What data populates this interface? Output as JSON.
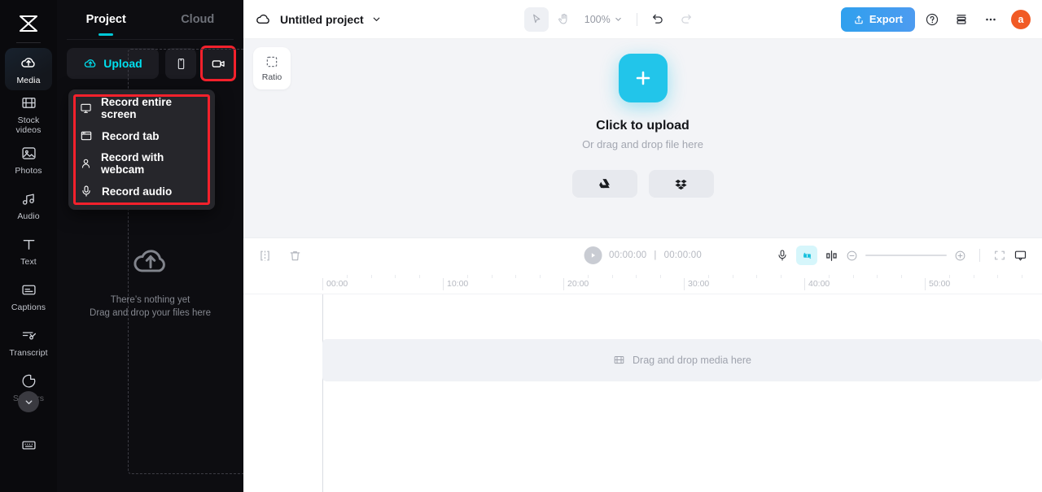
{
  "app": {
    "name": "CapCut",
    "logo_icon": "capcut-logo-icon"
  },
  "rail": {
    "items": [
      {
        "label": "Media",
        "icon": "cloud-upload-icon",
        "active": true
      },
      {
        "label": "Stock\nvideos",
        "icon": "film-strip-icon",
        "active": false
      },
      {
        "label": "Photos",
        "icon": "image-icon",
        "active": false
      },
      {
        "label": "Audio",
        "icon": "music-note-icon",
        "active": false
      },
      {
        "label": "Text",
        "icon": "text-t-icon",
        "active": false
      },
      {
        "label": "Captions",
        "icon": "captions-icon",
        "active": false
      },
      {
        "label": "Transcript",
        "icon": "transcript-icon",
        "active": false
      },
      {
        "label": "Stickers",
        "icon": "sticker-icon",
        "active": false
      }
    ],
    "expand_icon": "chevron-down-icon",
    "bottom_icon": "keyboard-icon"
  },
  "panel": {
    "tabs": [
      {
        "label": "Project",
        "active": true
      },
      {
        "label": "Cloud",
        "active": false
      }
    ],
    "upload_label": "Upload",
    "upload_icon": "cloud-upload-icon",
    "phone_icon": "phone-icon",
    "record_icon": "video-camera-icon",
    "highlight_color": "#f5212c",
    "dropdown": {
      "items": [
        {
          "label": "Record entire screen",
          "icon": "monitor-icon"
        },
        {
          "label": "Record tab",
          "icon": "browser-tab-icon"
        },
        {
          "label": "Record with webcam",
          "icon": "person-icon"
        },
        {
          "label": "Record audio",
          "icon": "microphone-icon"
        }
      ]
    },
    "empty": {
      "icon": "cloud-upload-icon",
      "line1": "There’s nothing yet",
      "line2": "Drag and drop your files here"
    },
    "collapse_icon": "chevron-left-icon"
  },
  "topbar": {
    "cloud_icon": "cloud-icon",
    "project_title": "Untitled project",
    "title_chevron_icon": "chevron-down-icon",
    "select_tool_icon": "cursor-arrow-icon",
    "hand_tool_icon": "hand-icon",
    "zoom_value": "100%",
    "zoom_chevron_icon": "chevron-down-icon",
    "undo_icon": "undo-icon",
    "redo_icon": "redo-icon",
    "export_label": "Export",
    "export_icon": "share-upload-icon",
    "export_color": "#2fa0ee",
    "help_icon": "question-circle-icon",
    "layers_icon": "layers-icon",
    "more_icon": "ellipsis-icon",
    "avatar_letter": "a",
    "avatar_color": "#f15a24"
  },
  "canvas": {
    "ratio_label": "Ratio",
    "ratio_icon": "crop-frame-icon",
    "plus_icon": "plus-icon",
    "plus_color": "#22c5ea",
    "upload_title": "Click to upload",
    "upload_subtitle": "Or drag and drop file here",
    "cloud_buttons": [
      {
        "name": "google-drive",
        "icon": "google-drive-icon"
      },
      {
        "name": "dropbox",
        "icon": "dropbox-icon"
      }
    ]
  },
  "timeline": {
    "split_icon": "split-clip-icon",
    "delete_icon": "trash-icon",
    "play_icon": "play-icon",
    "current_time": "00:00:00",
    "time_separator": "|",
    "total_time": "00:00:00",
    "mic_icon": "microphone-icon",
    "magic_icon": "auto-edit-icon",
    "magic_color": "#22c5ea",
    "mix_icon": "split-screen-icon",
    "zoom_out_icon": "minus-circle-icon",
    "zoom_in_icon": "plus-circle-icon",
    "fit_icon": "fit-screen-icon",
    "preview_icon": "monitor-preview-icon",
    "ruler_ticks": [
      "00:00",
      "10:00",
      "20:00",
      "30:00",
      "40:00",
      "50:00"
    ],
    "drop_text": "Drag and drop media here",
    "drop_icon": "film-strip-icon"
  }
}
